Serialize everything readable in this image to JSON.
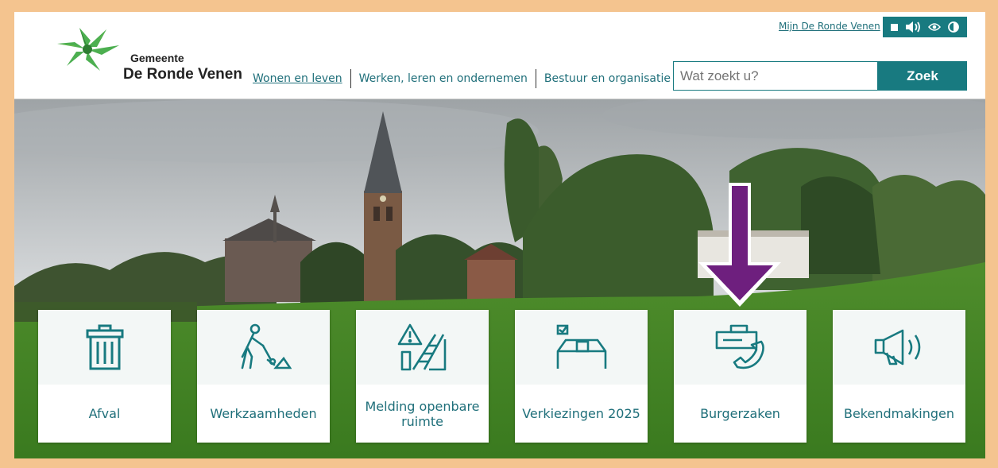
{
  "header": {
    "org_small": "Gemeente",
    "org_name": "De Ronde Venen",
    "mijn_link": "Mijn De Ronde Venen",
    "logo": "flower-logo-icon"
  },
  "nav": {
    "items": [
      {
        "label": "Wonen en leven",
        "active": true
      },
      {
        "label": "Werken, leren en ondernemen"
      },
      {
        "label": "Bestuur en organisatie"
      }
    ]
  },
  "toolbar": {
    "icons": [
      "stop-icon",
      "speaker-icon",
      "eye-icon",
      "contrast-icon"
    ]
  },
  "search": {
    "placeholder": "Wat zoekt u?",
    "button_label": "Zoek"
  },
  "tiles": [
    {
      "label": "Afval",
      "icon": "trash-bin-icon"
    },
    {
      "label": "Werkzaamheden",
      "icon": "road-worker-icon"
    },
    {
      "label": "Melding openbare ruimte",
      "icon": "warning-ladder-icon"
    },
    {
      "label": "Verkiezingen 2025",
      "icon": "ballot-box-icon"
    },
    {
      "label": "Burgerzaken",
      "icon": "ticket-phone-icon"
    },
    {
      "label": "Bekendmakingen",
      "icon": "megaphone-icon"
    }
  ],
  "annotation": {
    "icon": "purple-down-arrow-icon",
    "color": "#6e1f7e"
  },
  "colors": {
    "accent": "#187a80",
    "frame": "#f4c48f",
    "link": "#1f6f7a"
  }
}
